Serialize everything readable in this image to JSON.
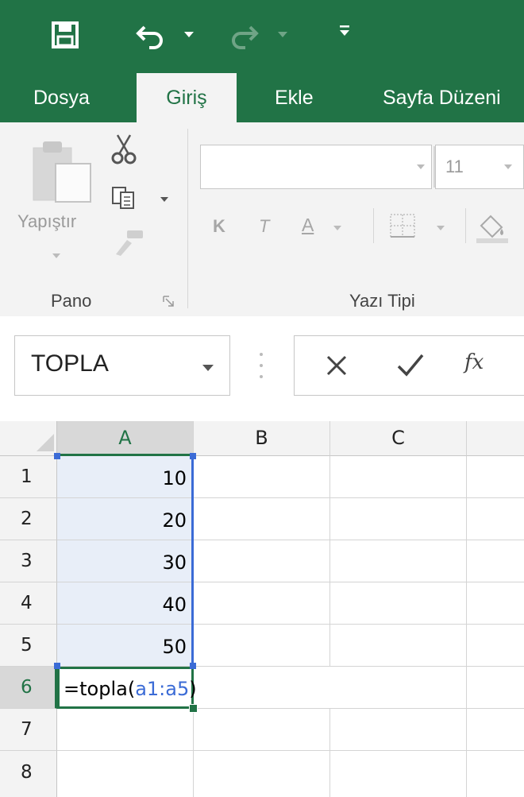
{
  "quick_access": {
    "save_icon": "save-icon",
    "undo_icon": "undo-icon",
    "redo_icon": "redo-icon",
    "customize_icon": "customize-qat-icon"
  },
  "tabs": [
    {
      "label": "Dosya",
      "active": false
    },
    {
      "label": "Giriş",
      "active": true
    },
    {
      "label": "Ekle",
      "active": false
    },
    {
      "label": "Sayfa Düzeni",
      "active": false
    }
  ],
  "ribbon": {
    "clipboard": {
      "paste_label": "Yapıştır",
      "group_label": "Pano"
    },
    "font": {
      "font_name": "",
      "font_size": "11",
      "bold": "K",
      "italic": "T",
      "underline": "A",
      "group_label": "Yazı Tipi"
    }
  },
  "formula_bar": {
    "name_box": "TOPLA",
    "fx_label": "fx"
  },
  "sheet": {
    "columns": [
      "A",
      "B",
      "C"
    ],
    "rows": [
      "1",
      "2",
      "3",
      "4",
      "5",
      "6",
      "7",
      "8"
    ],
    "values": [
      "10",
      "20",
      "30",
      "40",
      "50"
    ],
    "formula_prefix": "=topla(",
    "formula_ref": "a1:a5",
    "formula_suffix": ")"
  },
  "colors": {
    "accent": "#217346",
    "ref_blue": "#3b6bd6",
    "range_fill": "#e8eef8"
  }
}
